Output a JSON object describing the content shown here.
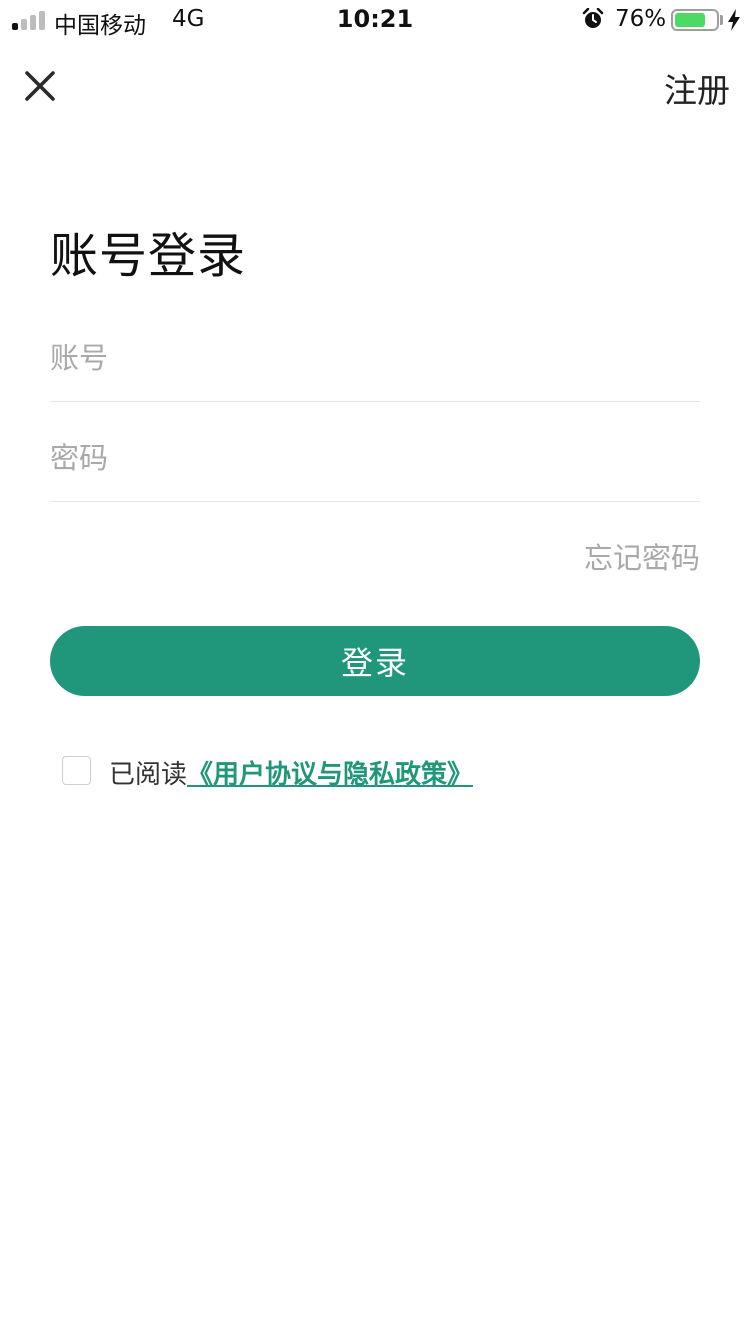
{
  "status_bar": {
    "carrier": "中国移动",
    "network": "4G",
    "time": "10:21",
    "battery_percent_text": "76%",
    "battery_level": 0.76,
    "signal_bars_active": 1,
    "signal_bars_total": 4,
    "icons": [
      "signal-icon",
      "alarm-icon",
      "battery-icon",
      "charging-icon"
    ],
    "battery_color": "#4cd964"
  },
  "nav": {
    "close_icon": "close-icon",
    "register_label": "注册"
  },
  "page": {
    "title": "账号登录"
  },
  "form": {
    "account_placeholder": "账号",
    "account_value": "",
    "password_placeholder": "密码",
    "password_value": "",
    "forgot_label": "忘记密码",
    "login_label": "登录",
    "accent_color": "#20977a"
  },
  "agreement": {
    "checked": false,
    "prefix": "已阅读",
    "link": "《用户协议与隐私政策》"
  }
}
